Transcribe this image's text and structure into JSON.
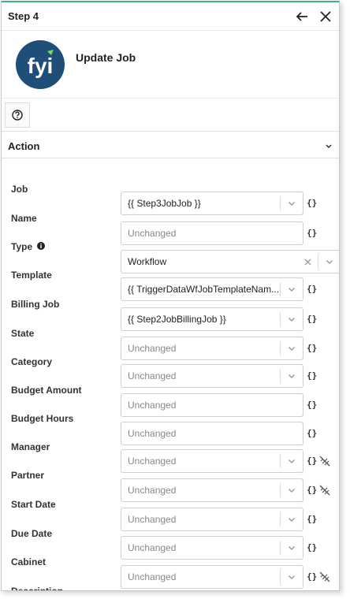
{
  "window": {
    "title": "Step 4"
  },
  "header": {
    "job_title": "Update Job",
    "logo_text": "fyi"
  },
  "section": {
    "label": "Action"
  },
  "fields": [
    {
      "label": "Job",
      "value": "{{ Step3JobJob }}",
      "placeholder": false,
      "kind": "select"
    },
    {
      "label": "Name",
      "value": "Unchanged",
      "placeholder": true,
      "kind": "text"
    },
    {
      "label": "Type",
      "value": "Workflow",
      "placeholder": false,
      "kind": "select-clear"
    },
    {
      "label": "Template",
      "value": "{{ TriggerDataWfJobTemplateNam...",
      "placeholder": false,
      "kind": "select"
    },
    {
      "label": "Billing Job",
      "value": "{{ Step2JobBillingJob }}",
      "placeholder": false,
      "kind": "select"
    },
    {
      "label": "State",
      "value": "Unchanged",
      "placeholder": true,
      "kind": "select"
    },
    {
      "label": "Category",
      "value": "Unchanged",
      "placeholder": true,
      "kind": "select"
    },
    {
      "label": "Budget Amount",
      "value": "Unchanged",
      "placeholder": true,
      "kind": "text"
    },
    {
      "label": "Budget Hours",
      "value": "Unchanged",
      "placeholder": true,
      "kind": "text"
    },
    {
      "label": "Manager",
      "value": "Unchanged",
      "placeholder": true,
      "kind": "select"
    },
    {
      "label": "Partner",
      "value": "Unchanged",
      "placeholder": true,
      "kind": "select"
    },
    {
      "label": "Start Date",
      "value": "Unchanged",
      "placeholder": true,
      "kind": "select"
    },
    {
      "label": "Due Date",
      "value": "Unchanged",
      "placeholder": true,
      "kind": "select"
    },
    {
      "label": "Cabinet",
      "value": "Unchanged",
      "placeholder": true,
      "kind": "select"
    },
    {
      "label": "Description",
      "value": "",
      "placeholder": true,
      "kind": "textarea"
    }
  ],
  "brace_symbol": "{}",
  "colors": {
    "accent": "#3bb77e",
    "logo_bg": "#1f4e79"
  }
}
